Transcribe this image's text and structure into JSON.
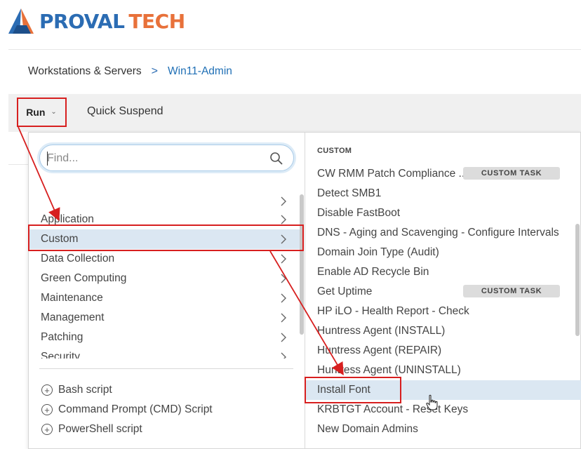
{
  "brand": {
    "logo_pro": "PROVAL",
    "logo_tech": "TECH",
    "colors": {
      "blue": "#2b6cb3",
      "orange": "#e8713a"
    }
  },
  "breadcrumb": {
    "parent": "Workstations & Servers",
    "separator": ">",
    "current": "Win11-Admin"
  },
  "toolbar": {
    "run_label": "Run",
    "quick_suspend_label": "Quick Suspend"
  },
  "search": {
    "placeholder": "Find...",
    "icon": "search-icon"
  },
  "categories": {
    "items": [
      {
        "label": ""
      },
      {
        "label": "Application"
      },
      {
        "label": "Custom",
        "selected": true
      },
      {
        "label": "Data Collection"
      },
      {
        "label": "Green Computing"
      },
      {
        "label": "Maintenance"
      },
      {
        "label": "Management"
      },
      {
        "label": "Patching"
      },
      {
        "label": "Security"
      }
    ]
  },
  "new_script": {
    "items": [
      {
        "label": "Bash script"
      },
      {
        "label": "Command Prompt (CMD) Script"
      },
      {
        "label": "PowerShell script"
      }
    ]
  },
  "scripts": {
    "section_title": "CUSTOM",
    "badge_label": "CUSTOM TASK",
    "items": [
      {
        "label": "CW RMM Patch Compliance ...",
        "badge": true
      },
      {
        "label": "Detect SMB1"
      },
      {
        "label": "Disable FastBoot"
      },
      {
        "label": "DNS - Aging and Scavenging - Configure Intervals"
      },
      {
        "label": "Domain Join Type (Audit)"
      },
      {
        "label": "Enable AD Recycle Bin"
      },
      {
        "label": "Get Uptime",
        "badge": true
      },
      {
        "label": "HP iLO - Health Report - Check"
      },
      {
        "label": "Huntress Agent (INSTALL)"
      },
      {
        "label": "Huntress Agent (REPAIR)"
      },
      {
        "label": "Huntress Agent (UNINSTALL)"
      },
      {
        "label": "Install Font",
        "selected": true
      },
      {
        "label": "KRBTGT Account - Reset Keys"
      },
      {
        "label": "New Domain Admins"
      }
    ]
  },
  "annotation_color": "#d71f1f"
}
